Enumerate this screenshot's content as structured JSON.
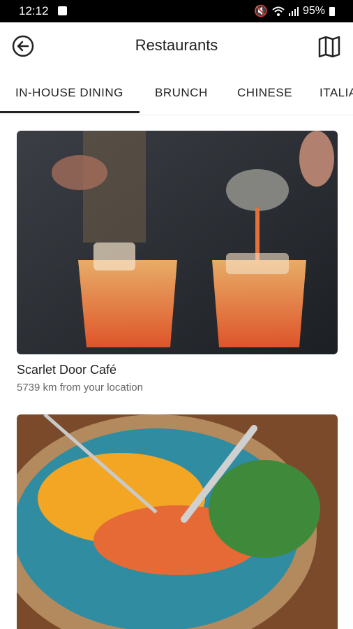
{
  "status": {
    "time": "12:12",
    "battery": "95%"
  },
  "appbar": {
    "title": "Restaurants"
  },
  "tabs": [
    "IN-HOUSE DINING",
    "BRUNCH",
    "CHINESE",
    "ITALIAN"
  ],
  "restaurants": [
    {
      "name": "Scarlet Door Café",
      "distance": "5739 km from your location"
    }
  ],
  "icons": {
    "back": "back-arrow-icon",
    "map": "map-icon"
  },
  "colors": {
    "accent": "#222222",
    "statusbar": "#000000"
  }
}
